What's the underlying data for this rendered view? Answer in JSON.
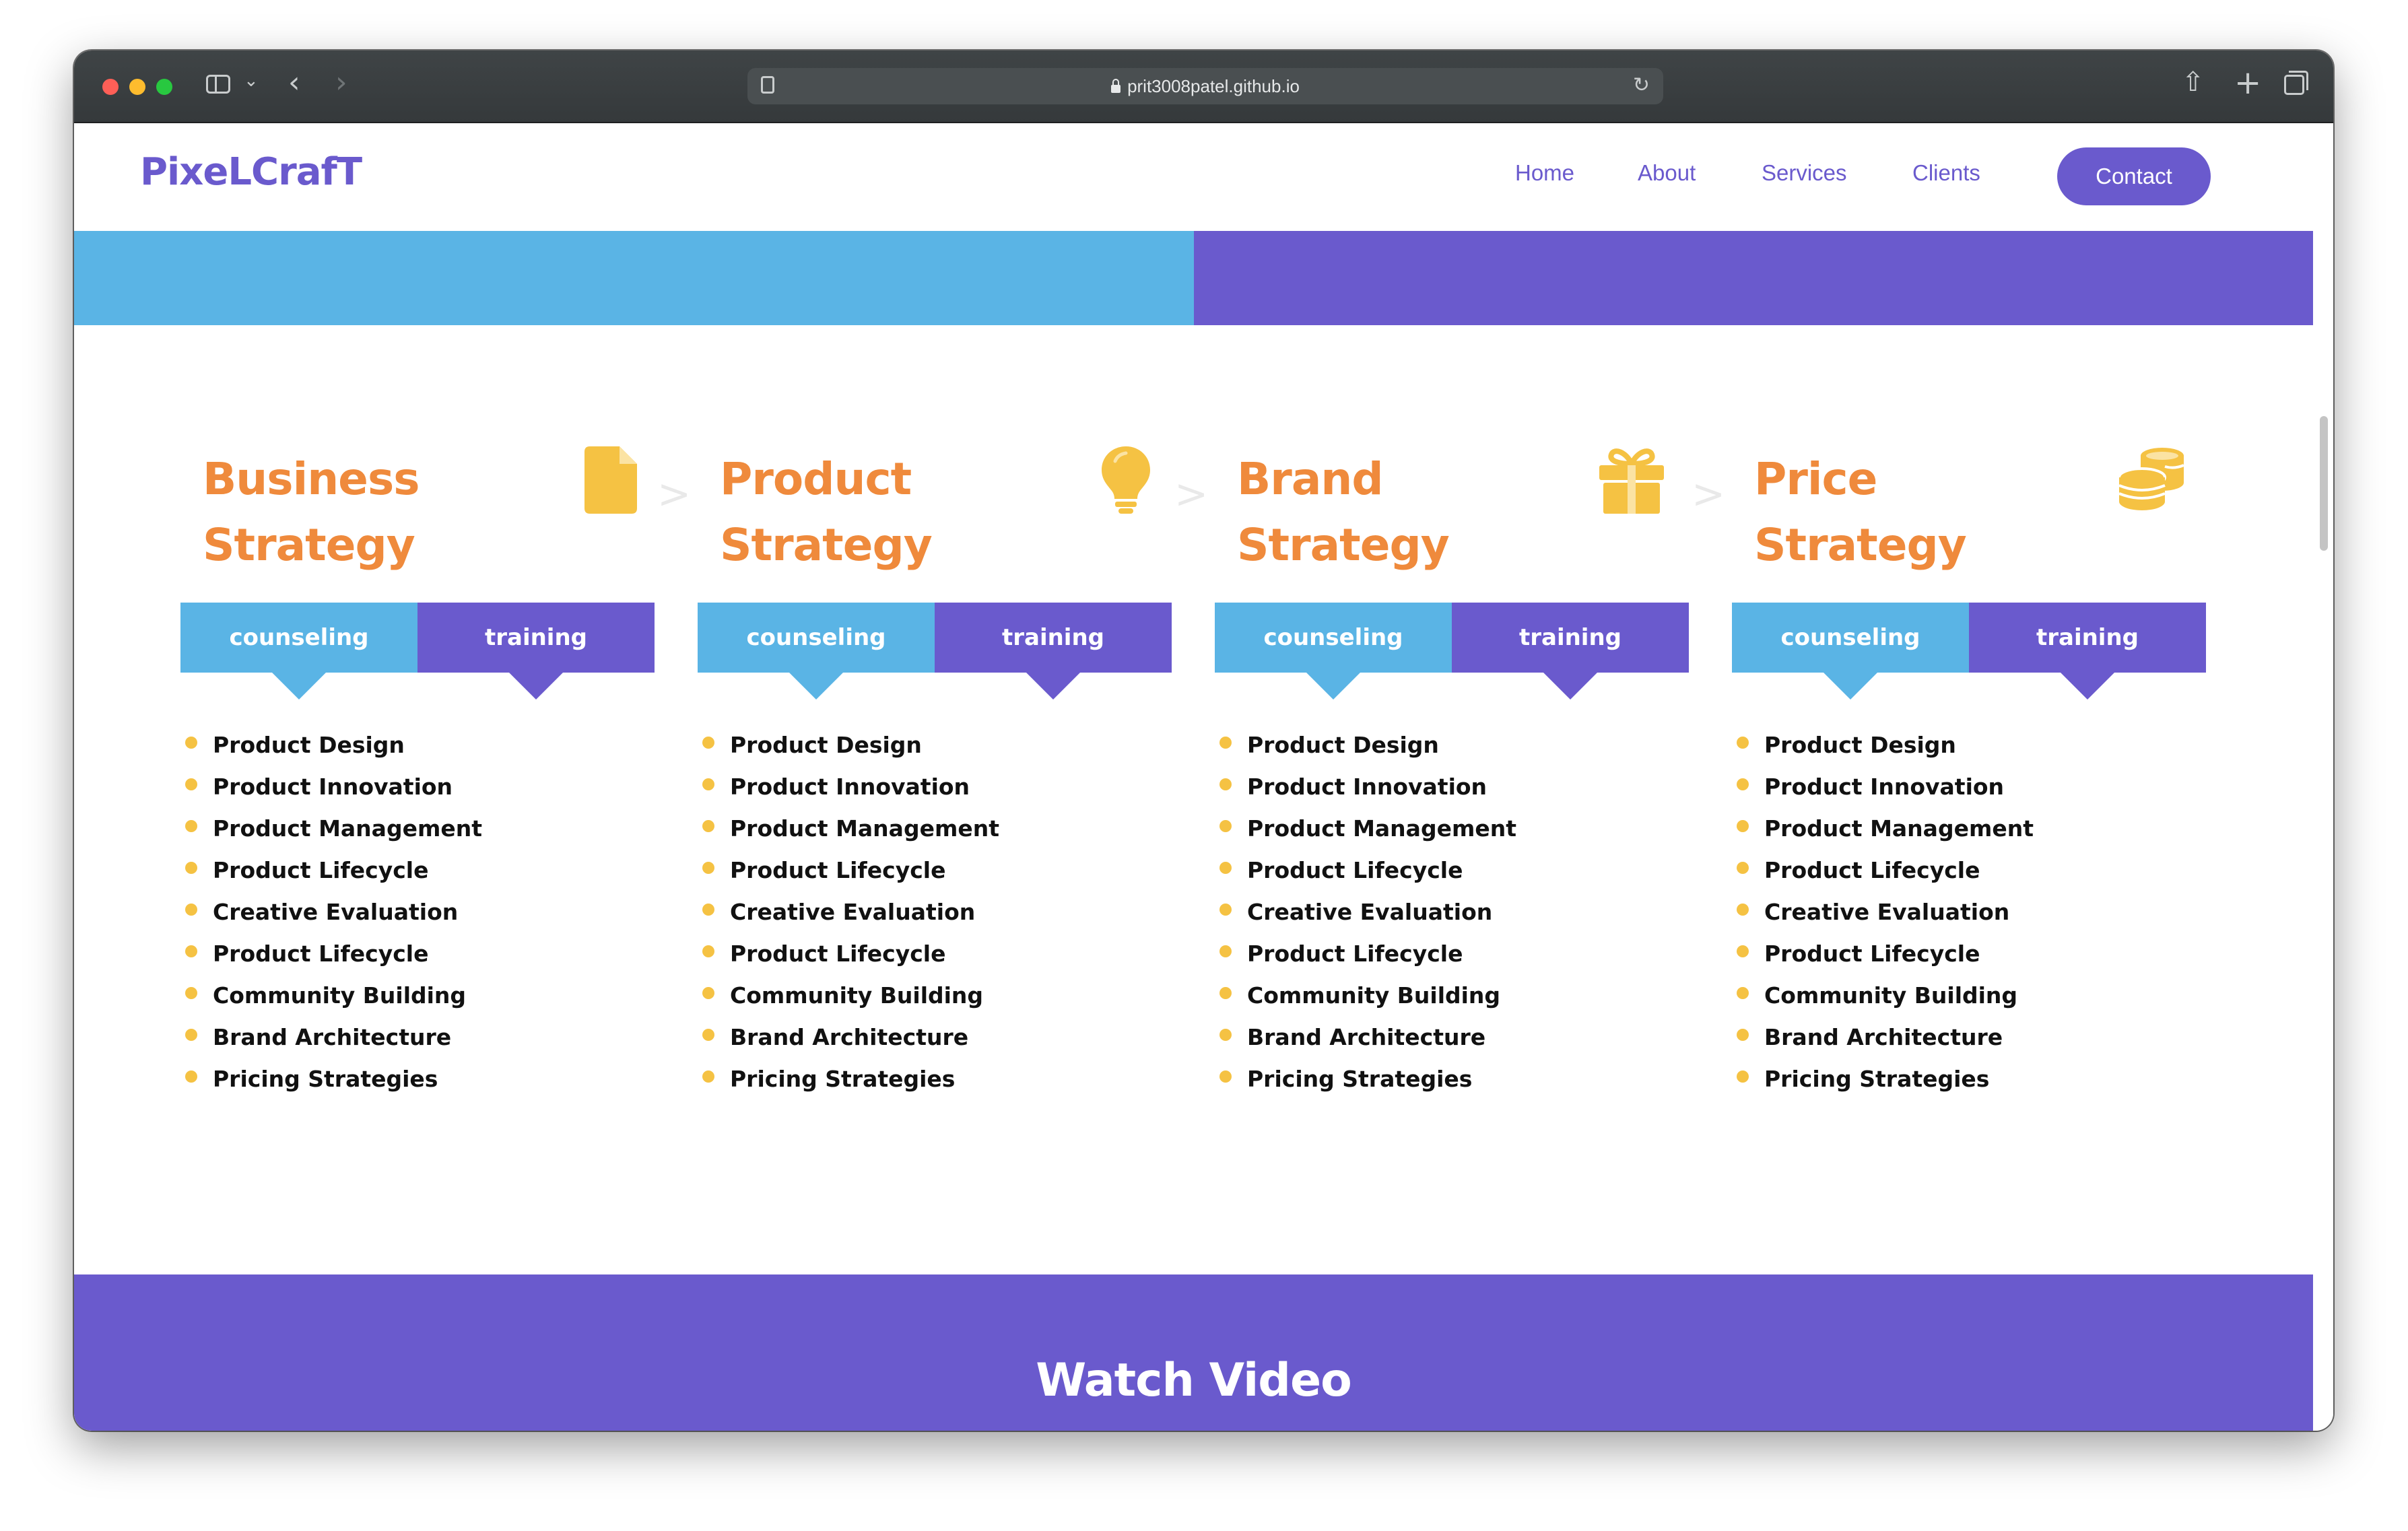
{
  "browser": {
    "url": "prit3008patel.github.io"
  },
  "nav": {
    "logo": "PixeLCrafT",
    "links": [
      "Home",
      "About",
      "Services",
      "Clients"
    ],
    "cta": "Contact"
  },
  "colors": {
    "brand_purple": "#6a5acd",
    "accent_blue": "#5ab4e5",
    "heading_orange": "#ef8a3c",
    "icon_yellow": "#f5c243"
  },
  "strategies": [
    {
      "title_line1": "Business",
      "title_line2": "Strategy",
      "icon": "document-icon",
      "tab_left": "counseling",
      "tab_right": "training",
      "items": [
        "Product Design",
        "Product Innovation",
        "Product Management",
        "Product Lifecycle",
        "Creative Evaluation",
        "Product Lifecycle",
        "Community Building",
        "Brand Architecture",
        "Pricing Strategies"
      ]
    },
    {
      "title_line1": "Product",
      "title_line2": "Strategy",
      "icon": "lightbulb-icon",
      "tab_left": "counseling",
      "tab_right": "training",
      "items": [
        "Product Design",
        "Product Innovation",
        "Product Management",
        "Product Lifecycle",
        "Creative Evaluation",
        "Product Lifecycle",
        "Community Building",
        "Brand Architecture",
        "Pricing Strategies"
      ]
    },
    {
      "title_line1": "Brand",
      "title_line2": "Strategy",
      "icon": "gift-icon",
      "tab_left": "counseling",
      "tab_right": "training",
      "items": [
        "Product Design",
        "Product Innovation",
        "Product Management",
        "Product Lifecycle",
        "Creative Evaluation",
        "Product Lifecycle",
        "Community Building",
        "Brand Architecture",
        "Pricing Strategies"
      ]
    },
    {
      "title_line1": "Price",
      "title_line2": "Strategy",
      "icon": "coins-icon",
      "tab_left": "counseling",
      "tab_right": "training",
      "items": [
        "Product Design",
        "Product Innovation",
        "Product Management",
        "Product Lifecycle",
        "Creative Evaluation",
        "Product Lifecycle",
        "Community Building",
        "Brand Architecture",
        "Pricing Strategies"
      ]
    }
  ],
  "separator": ">",
  "video": {
    "title": "Watch Video"
  }
}
